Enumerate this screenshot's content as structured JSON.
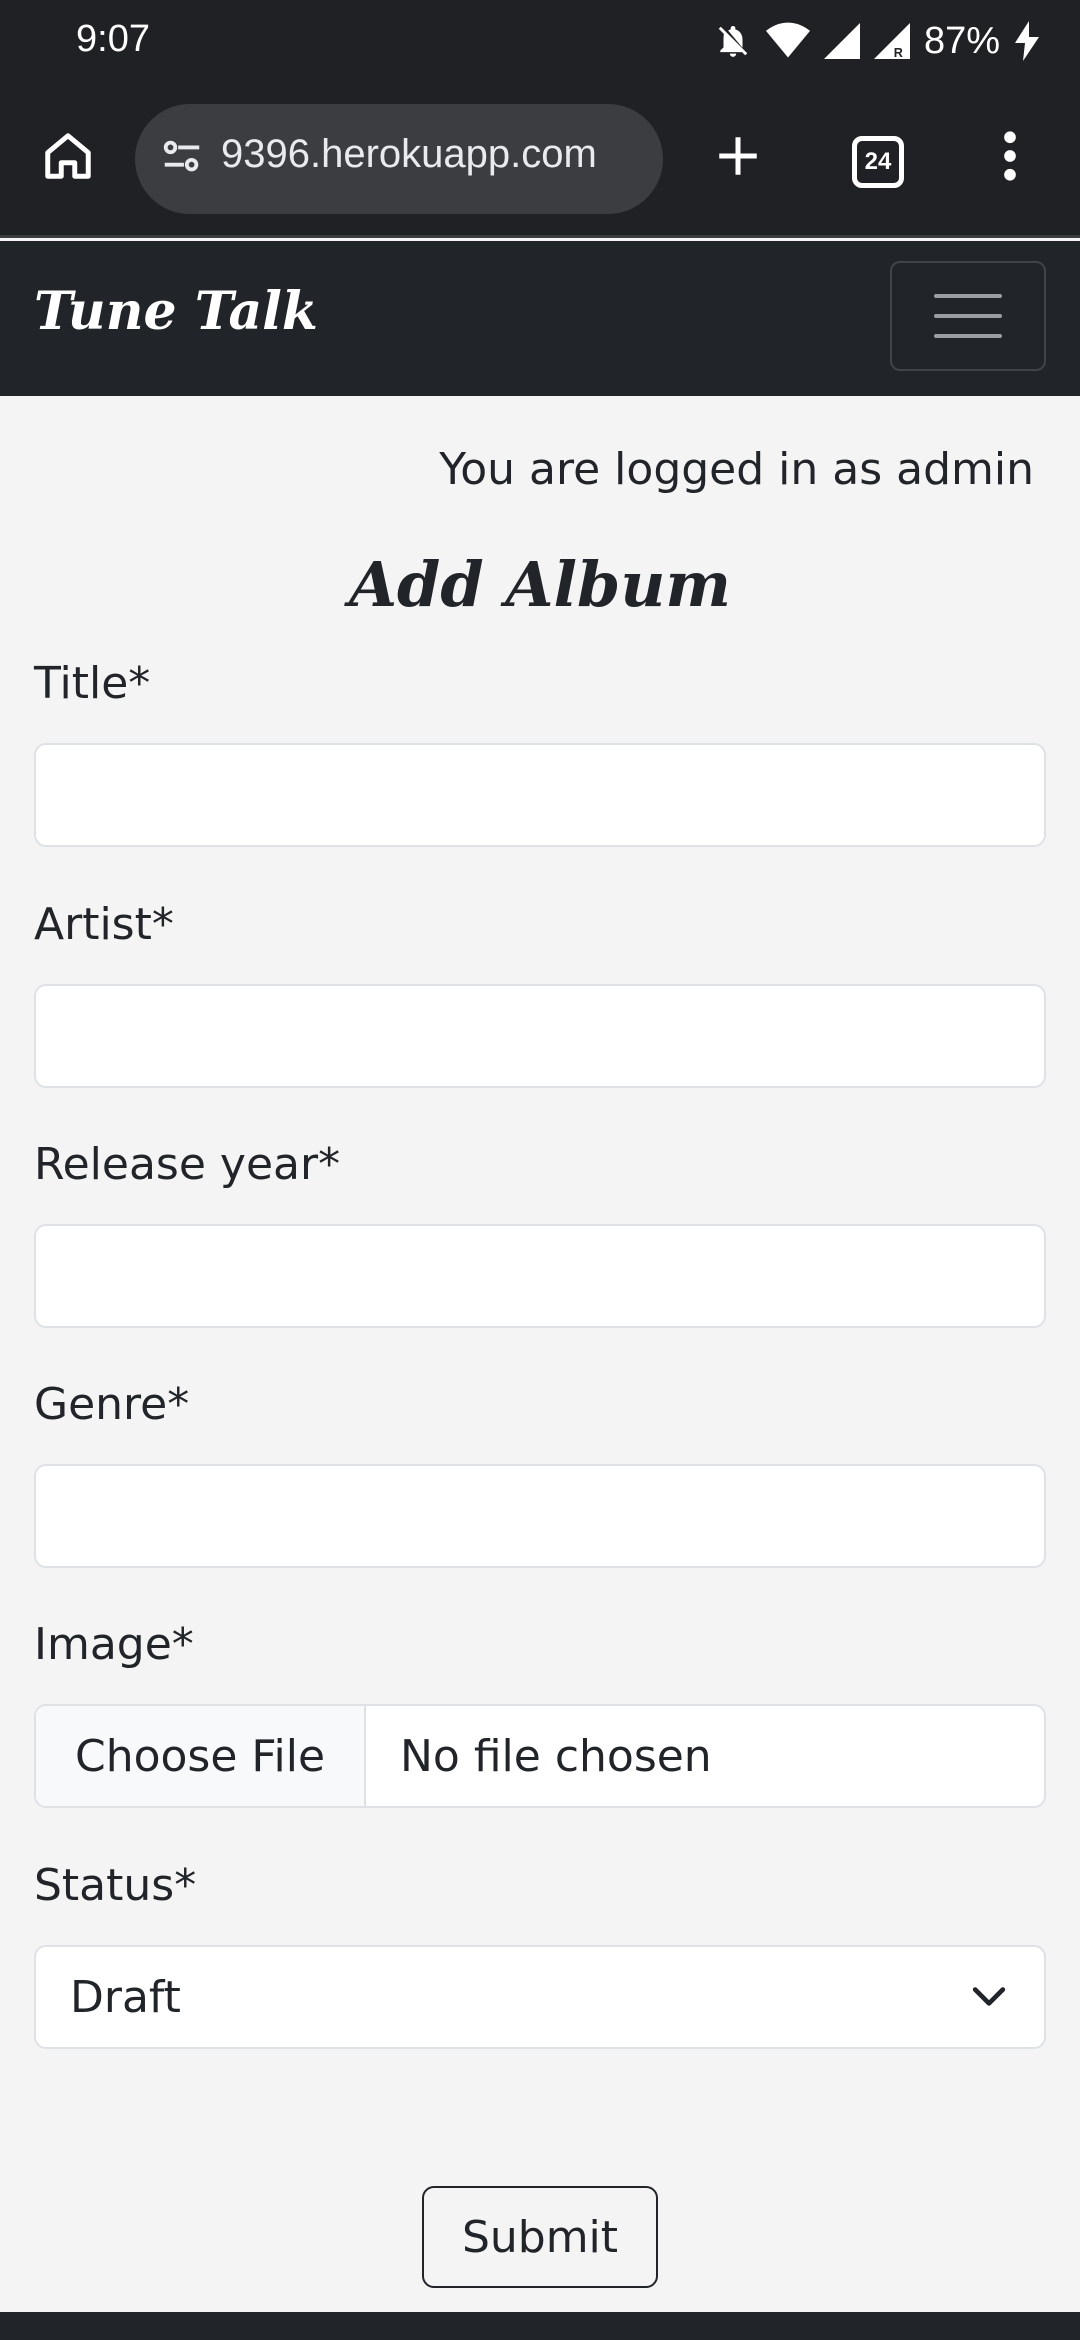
{
  "status_bar": {
    "time": "9:07",
    "battery": "87%",
    "icons": [
      "bell-off-icon",
      "wifi-icon",
      "signal-icon",
      "signal-roaming-icon",
      "battery-charging-icon"
    ]
  },
  "browser": {
    "url": "9396.herokuapp.com",
    "tab_count": "24"
  },
  "navbar": {
    "brand": "Tune Talk"
  },
  "page": {
    "logged_in_text": "You are logged in as admin",
    "title": "Add Album"
  },
  "form": {
    "title_label": "Title*",
    "title_value": "",
    "artist_label": "Artist*",
    "artist_value": "",
    "release_year_label": "Release year*",
    "release_year_value": "",
    "genre_label": "Genre*",
    "genre_value": "",
    "image_label": "Image*",
    "file_button": "Choose File",
    "file_status": "No file chosen",
    "status_label": "Status*",
    "status_value": "Draft",
    "submit_label": "Submit"
  },
  "colors": {
    "navbar_bg": "#212529",
    "browser_bg": "#202124",
    "page_bg": "#f4f4f4"
  }
}
